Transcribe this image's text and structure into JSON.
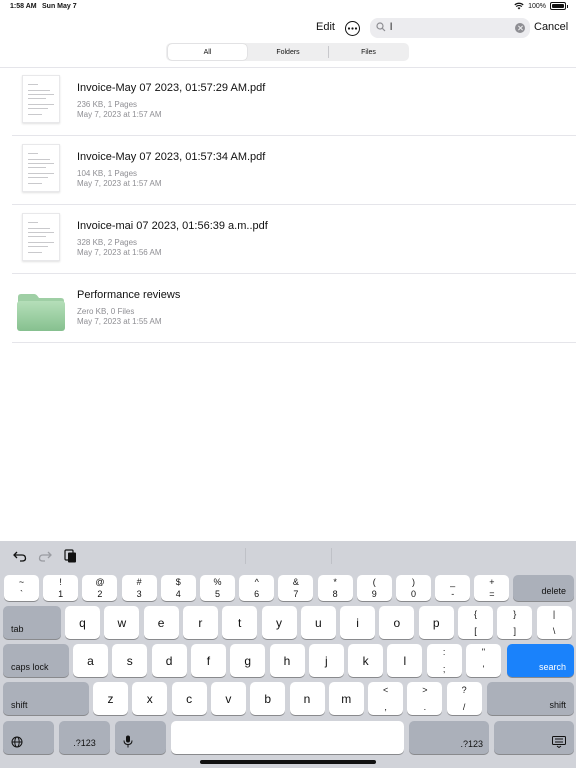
{
  "status_bar": {
    "time": "1:58 AM",
    "date": "Sun May 7",
    "battery": "100%",
    "battery_level": 1.0
  },
  "toolbar": {
    "edit_label": "Edit",
    "more_icon": "ellipsis-circle-icon",
    "search_value": "l",
    "cancel_label": "Cancel"
  },
  "scope": {
    "tabs": [
      "All",
      "Folders",
      "Files"
    ],
    "selected": "All"
  },
  "items": [
    {
      "kind": "pdf",
      "title": "Invoice-May 07 2023, 01:57:29 AM.pdf",
      "size": "236 KB, 1 Pages",
      "date": "May 7, 2023 at 1:57 AM"
    },
    {
      "kind": "pdf",
      "title": "Invoice-May 07 2023, 01:57:34 AM.pdf",
      "size": "104 KB, 1 Pages",
      "date": "May 7, 2023 at 1:57 AM"
    },
    {
      "kind": "pdf",
      "title": "Invoice-mai 07 2023, 01:56:39 a.m..pdf",
      "size": "328 KB, 2 Pages",
      "date": "May 7, 2023 at 1:56 AM"
    },
    {
      "kind": "folder",
      "title": "Performance reviews",
      "size": "Zero KB, 0 Files",
      "date": "May 7, 2023 at 1:55 AM"
    }
  ],
  "colors": {
    "accent": "#1a82fb",
    "folder": "#9fd2a6",
    "keyboard_bg": "#d1d3d9"
  },
  "keyboard": {
    "number_row": [
      {
        "alt": "~",
        "main": "`"
      },
      {
        "alt": "!",
        "main": "1"
      },
      {
        "alt": "@",
        "main": "2"
      },
      {
        "alt": "#",
        "main": "3"
      },
      {
        "alt": "$",
        "main": "4"
      },
      {
        "alt": "%",
        "main": "5"
      },
      {
        "alt": "^",
        "main": "6"
      },
      {
        "alt": "&",
        "main": "7"
      },
      {
        "alt": "*",
        "main": "8"
      },
      {
        "alt": "(",
        "main": "9"
      },
      {
        "alt": ")",
        "main": "0"
      },
      {
        "alt": "_",
        "main": "-"
      },
      {
        "alt": "+",
        "main": "="
      }
    ],
    "delete_label": "delete",
    "tab_label": "tab",
    "row_q": [
      "q",
      "w",
      "e",
      "r",
      "t",
      "y",
      "u",
      "i",
      "o",
      "p"
    ],
    "row_q_symbols": [
      {
        "alt": "{",
        "main": "["
      },
      {
        "alt": "}",
        "main": "]"
      },
      {
        "alt": "|",
        "main": "\\"
      }
    ],
    "caps_label": "caps lock",
    "row_a": [
      "a",
      "s",
      "d",
      "f",
      "g",
      "h",
      "j",
      "k",
      "l"
    ],
    "row_a_symbols": [
      {
        "alt": ":",
        "main": ";"
      },
      {
        "alt": "\"",
        "main": "'"
      }
    ],
    "search_label": "search",
    "shift_label": "shift",
    "row_z": [
      "z",
      "x",
      "c",
      "v",
      "b",
      "n",
      "m"
    ],
    "row_z_symbols": [
      {
        "alt": "<",
        "main": ","
      },
      {
        "alt": ">",
        "main": "."
      },
      {
        "alt": "?",
        "main": "/"
      }
    ],
    "numbers_label": ".?123",
    "icons": [
      "globe-icon",
      "microphone-icon",
      "keyboard-dismiss-icon",
      "undo-icon",
      "redo-icon",
      "paste-icon"
    ]
  }
}
